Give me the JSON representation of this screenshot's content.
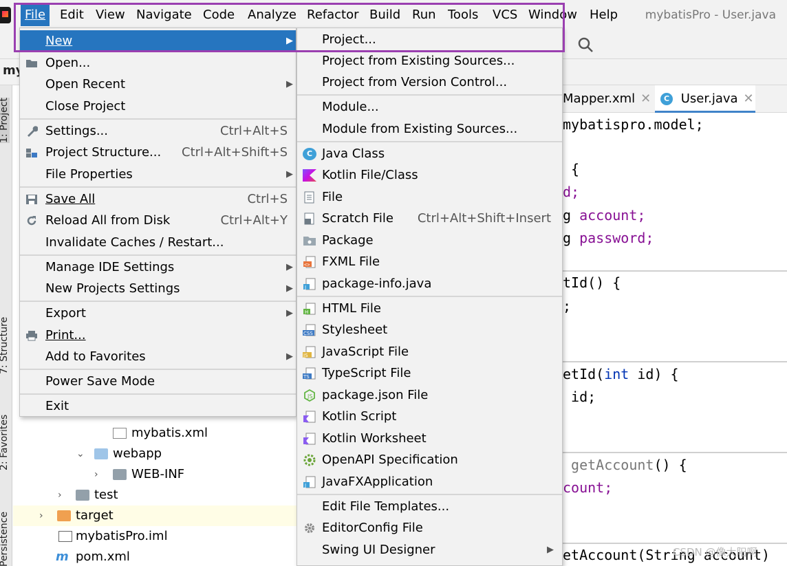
{
  "window_title": "mybatisPro - User.java",
  "menubar": {
    "items": [
      "File",
      "Edit",
      "View",
      "Navigate",
      "Code",
      "Analyze",
      "Refactor",
      "Build",
      "Run",
      "Tools",
      "VCS",
      "Window",
      "Help"
    ]
  },
  "navbar": {
    "project_label": "my"
  },
  "side_tabs": {
    "project": "1: Project",
    "structure": "7: Structure",
    "favorites": "2: Favorites",
    "persistence": "Persistence"
  },
  "file_menu": {
    "new": "New",
    "open": "Open...",
    "open_recent": "Open Recent",
    "close_project": "Close Project",
    "settings": "Settings...",
    "settings_shortcut": "Ctrl+Alt+S",
    "project_structure": "Project Structure...",
    "project_structure_shortcut": "Ctrl+Alt+Shift+S",
    "file_properties": "File Properties",
    "save_all": "Save All",
    "save_all_shortcut": "Ctrl+S",
    "reload": "Reload All from Disk",
    "reload_shortcut": "Ctrl+Alt+Y",
    "invalidate": "Invalidate Caches / Restart...",
    "manage_ide": "Manage IDE Settings",
    "new_projects_settings": "New Projects Settings",
    "export": "Export",
    "print": "Print...",
    "add_favorites": "Add to Favorites",
    "power_save": "Power Save Mode",
    "exit": "Exit"
  },
  "new_menu": {
    "project": "Project...",
    "project_existing": "Project from Existing Sources...",
    "project_vcs": "Project from Version Control...",
    "module": "Module...",
    "module_existing": "Module from Existing Sources...",
    "java_class": "Java Class",
    "kotlin_class": "Kotlin File/Class",
    "file": "File",
    "scratch": "Scratch File",
    "scratch_shortcut": "Ctrl+Alt+Shift+Insert",
    "package": "Package",
    "fxml": "FXML File",
    "package_info": "package-info.java",
    "html": "HTML File",
    "stylesheet": "Stylesheet",
    "javascript": "JavaScript File",
    "typescript": "TypeScript File",
    "package_json": "package.json File",
    "kotlin_script": "Kotlin Script",
    "kotlin_worksheet": "Kotlin Worksheet",
    "openapi": "OpenAPI Specification",
    "javafx": "JavaFXApplication",
    "edit_templates": "Edit File Templates...",
    "editorconfig": "EditorConfig File",
    "swing": "Swing UI Designer"
  },
  "tree": {
    "mybatis_xml": "mybatis.xml",
    "webapp": "webapp",
    "web_inf": "WEB-INF",
    "test": "test",
    "target": "target",
    "iml": "mybatisPro.iml",
    "pom": "pom.xml"
  },
  "editor_tabs": {
    "mapper": "Mapper.xml",
    "user": "User.java",
    "user_icon": "C"
  },
  "code": {
    "l1": "mybatispro.model;",
    "l2": " {",
    "l3": "d;",
    "l4_a": "g ",
    "l4_b": "account;",
    "l5_a": "g ",
    "l5_b": "password;",
    "l6": "tId() {",
    "l7": ";",
    "l8_a": "etId(",
    "l8_b": "int",
    "l8_c": " id) {",
    "l9": " id;",
    "l10_a": " getAccount",
    "l10_b": "() {",
    "l11": "count;",
    "l12": "etAccount(String account)"
  },
  "watermark": "CSDN @像大阳啊",
  "colors": {
    "accent": "#2675bf",
    "highlight_box": "#9a3fb0"
  }
}
